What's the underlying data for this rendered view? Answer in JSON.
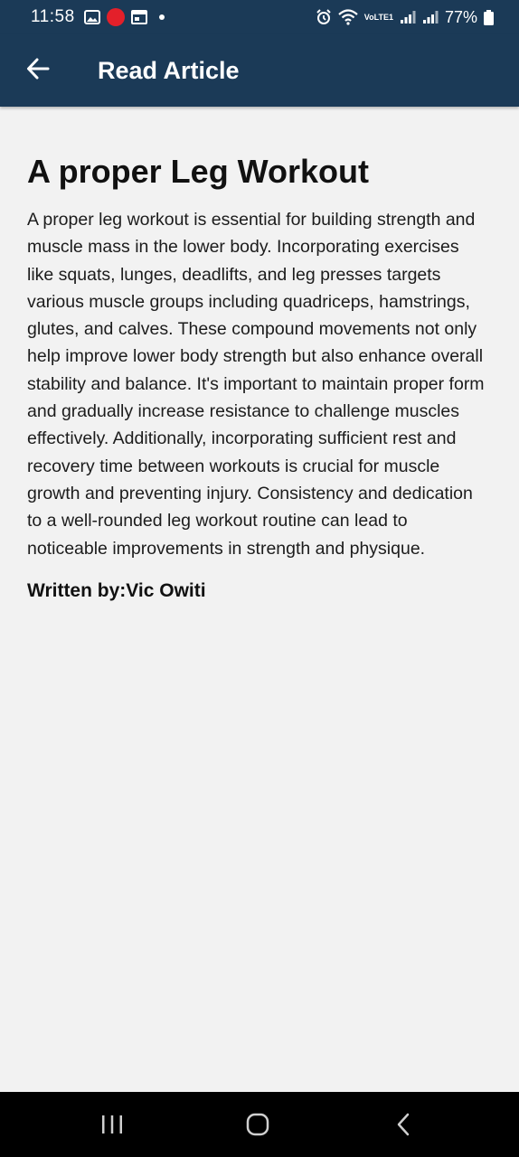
{
  "status_bar": {
    "time": "11:58",
    "network_label": "VoLTE1",
    "battery": "77%"
  },
  "app_bar": {
    "title": "Read Article"
  },
  "article": {
    "title": "A proper Leg Workout",
    "body": "A proper leg workout is essential for building strength and muscle mass in the lower body. Incorporating exercises like squats, lunges, deadlifts, and leg presses targets various muscle groups including quadriceps, hamstrings, glutes, and calves. These compound movements not only help improve lower body strength but also enhance overall stability and balance. It's important to maintain proper form and gradually increase resistance to challenge muscles effectively. Additionally, incorporating sufficient rest and recovery time between workouts is crucial for muscle growth and preventing injury. Consistency and dedication to a well-rounded leg workout routine can lead to noticeable improvements in strength and physique.",
    "author": "Written by:Vic Owiti"
  },
  "icons": {
    "back": "arrow-left-icon",
    "recents": "recent-apps-icon",
    "home": "home-icon",
    "nav_back": "chevron-left-icon"
  },
  "colors": {
    "app_bar": "#1b3a57",
    "background": "#f2f2f2",
    "nav_bar": "#000000"
  }
}
